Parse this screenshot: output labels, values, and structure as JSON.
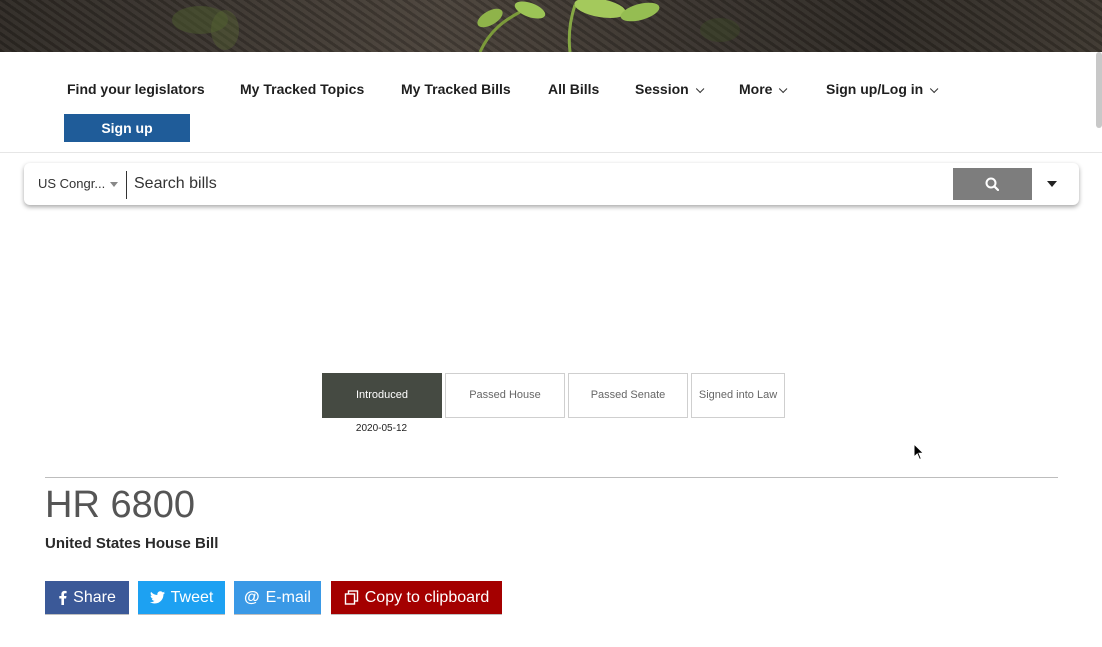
{
  "nav": {
    "items": [
      {
        "label": "Find your legislators"
      },
      {
        "label": "My Tracked Topics"
      },
      {
        "label": "My Tracked Bills"
      },
      {
        "label": "All Bills"
      },
      {
        "label": "Session"
      },
      {
        "label": "More"
      },
      {
        "label": "Sign up/Log in"
      }
    ],
    "signup_label": "Sign up"
  },
  "search": {
    "chamber_selected": "US Congr...",
    "placeholder": "Search bills"
  },
  "progress": {
    "stages": [
      {
        "label": "Introduced",
        "active": true,
        "date": "2020-05-12"
      },
      {
        "label": "Passed House",
        "active": false
      },
      {
        "label": "Passed Senate",
        "active": false
      },
      {
        "label": "Signed into Law",
        "active": false
      }
    ]
  },
  "bill": {
    "number": "HR 6800",
    "type": "United States House Bill"
  },
  "share": {
    "facebook_label": "Share",
    "twitter_label": "Tweet",
    "email_label": "E-mail",
    "clipboard_label": "Copy to clipboard"
  },
  "colors": {
    "signup": "#1f5c99",
    "search_button": "#7d7d7d",
    "stage_active": "#454a42",
    "facebook": "#3b5998",
    "twitter": "#1da1f2",
    "email": "#3a99e6",
    "clipboard": "#a40000"
  },
  "icons": {
    "search": "magnifier-icon",
    "facebook": "facebook-icon",
    "twitter": "twitter-icon",
    "email": "at-sign-icon",
    "clipboard": "clipboard-icon"
  }
}
